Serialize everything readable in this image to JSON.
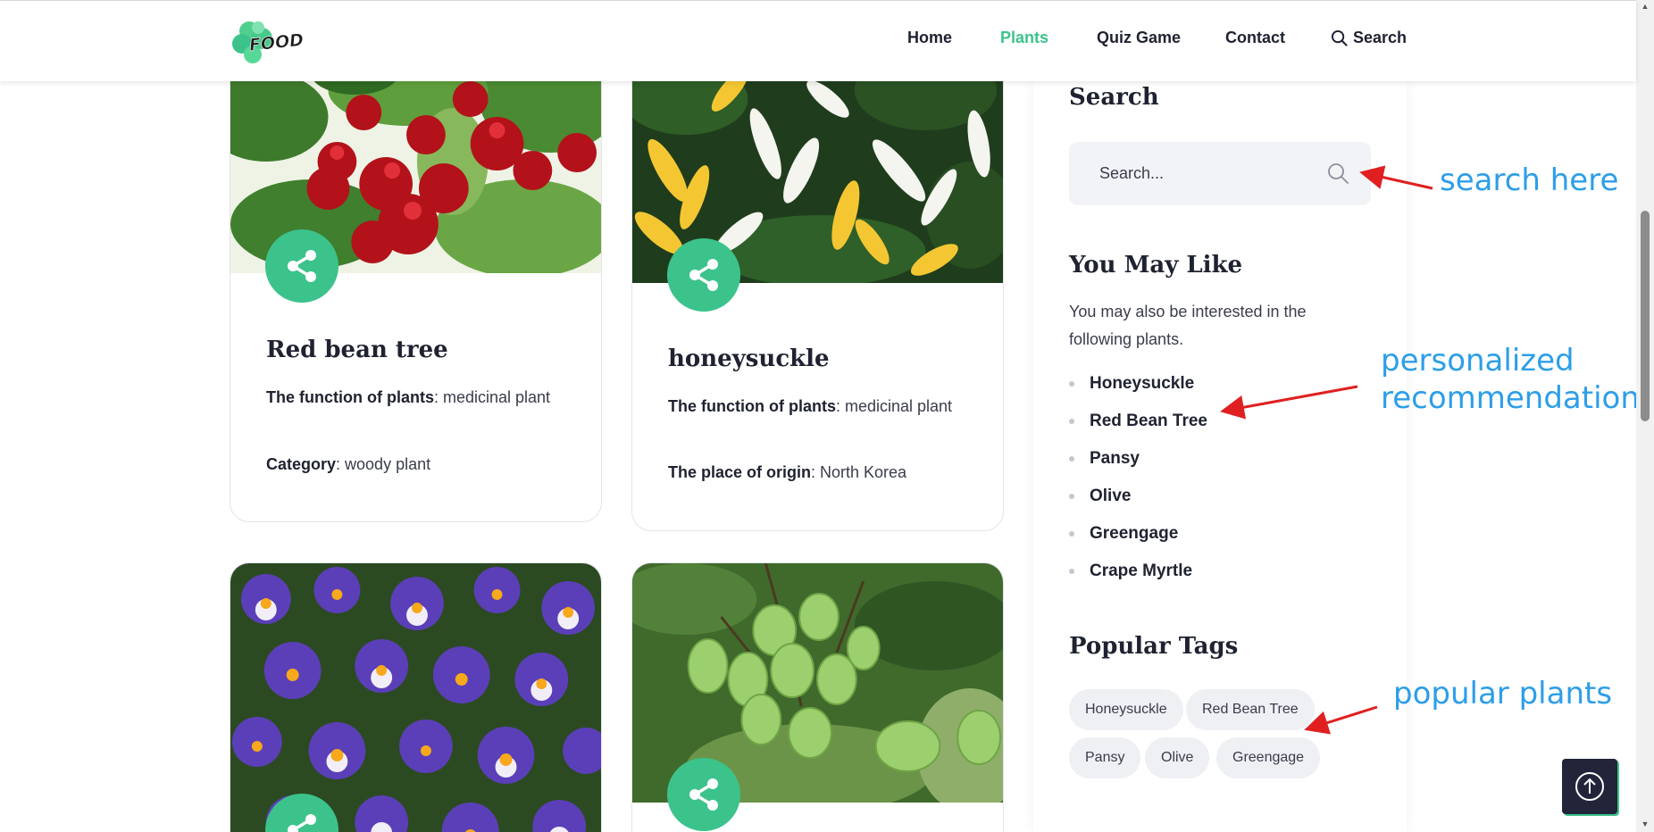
{
  "header": {
    "logo_text": "FOOD",
    "nav": {
      "home": "Home",
      "plants": "Plants",
      "quiz": "Quiz Game",
      "contact": "Contact",
      "search": "Search"
    },
    "active_color": "#3cc38c"
  },
  "cards": [
    {
      "title": "Red bean tree",
      "line1_label": "The function of plants",
      "line1_value": ": medicinal plant",
      "line2_label": "Category",
      "line2_value": ": woody plant"
    },
    {
      "title": "honeysuckle",
      "line1_label": "The function of plants",
      "line1_value": ": medicinal plant",
      "line2_label": "The place of origin",
      "line2_value": ": North Korea"
    }
  ],
  "sidebar": {
    "search_heading": "Search",
    "search_placeholder": "Search...",
    "like_heading": "You May Like",
    "like_text": "You may also be interested in the following plants.",
    "like_items": [
      "Honeysuckle",
      "Red Bean Tree",
      "Pansy",
      "Olive",
      "Greengage",
      "Crape Myrtle"
    ],
    "tags_heading": "Popular Tags",
    "tags": [
      "Honeysuckle",
      "Red Bean Tree",
      "Pansy",
      "Olive",
      "Greengage"
    ]
  },
  "annotations": {
    "search": "search here",
    "recommend_1": "personalized",
    "recommend_2": "recommendation",
    "popular": "popular plants",
    "color": "#2d9ee8"
  },
  "icons": {
    "share": "share-icon",
    "search": "search-icon",
    "up": "arrow-up-icon"
  }
}
